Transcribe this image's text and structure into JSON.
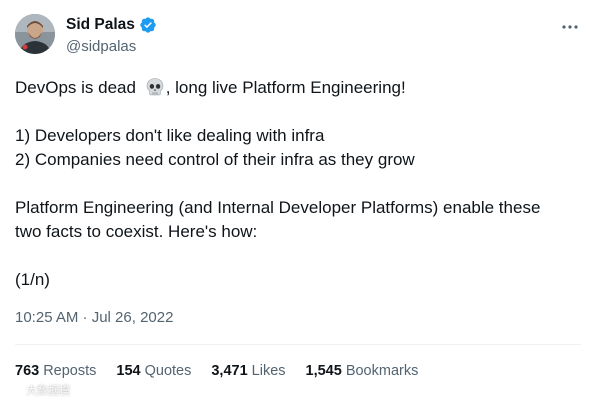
{
  "author": {
    "display_name": "Sid Palas",
    "handle": "@sidpalas",
    "verified": true
  },
  "body": {
    "line1_before": "DevOps is dead ",
    "line1_emoji": "skull-icon",
    "line1_after": ", long live Platform Engineering!",
    "line3": "1) Developers don't like dealing with infra",
    "line4": "2) Companies need control of their infra as they grow",
    "line6": "Platform Engineering (and Internal Developer Platforms) enable these",
    "line7": "two facts to coexist. Here's how:",
    "line9": "(1/n)"
  },
  "timestamp": "10:25 AM · Jul 26, 2022",
  "stats": [
    {
      "value": "763",
      "label": "Reposts"
    },
    {
      "value": "154",
      "label": "Quotes"
    },
    {
      "value": "3,471",
      "label": "Likes"
    },
    {
      "value": "1,545",
      "label": "Bookmarks"
    }
  ],
  "watermark": "大数据模",
  "colors": {
    "text": "#0f1419",
    "secondary": "#536471",
    "verified": "#1d9bf0",
    "divider": "#eff3f4"
  }
}
